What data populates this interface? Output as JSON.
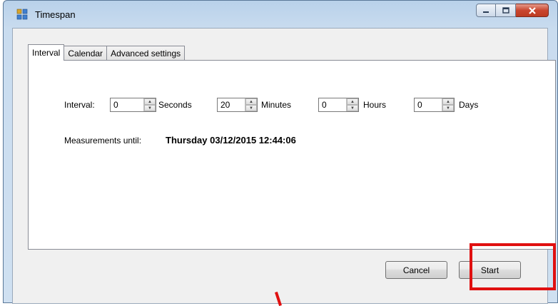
{
  "window": {
    "title": "Timespan"
  },
  "tabs": [
    {
      "label": "Interval",
      "active": true
    },
    {
      "label": "Calendar",
      "active": false
    },
    {
      "label": "Advanced settings",
      "active": false
    }
  ],
  "interval": {
    "label": "Interval:",
    "fields": [
      {
        "value": "0",
        "unit": "Seconds"
      },
      {
        "value": "20",
        "unit": "Minutes"
      },
      {
        "value": "0",
        "unit": "Hours"
      },
      {
        "value": "0",
        "unit": "Days"
      }
    ]
  },
  "measurements": {
    "label": "Measurements until:",
    "value": "Thursday 03/12/2015 12:44:06"
  },
  "buttons": {
    "cancel": "Cancel",
    "start": "Start"
  },
  "colors": {
    "highlight": "#e01010",
    "close_button": "#c9462f"
  }
}
